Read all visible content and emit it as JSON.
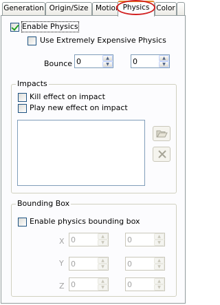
{
  "tabs": [
    {
      "label": "Generation",
      "active": false
    },
    {
      "label": "Origin/Size",
      "active": false
    },
    {
      "label": "Motion",
      "active": false
    },
    {
      "label": "Physics",
      "active": true
    },
    {
      "label": "Color",
      "active": false
    }
  ],
  "physics": {
    "enable_label": "Enable Physics",
    "enable_checked": true,
    "expensive_label": "Use Extremely Expensive Physics",
    "expensive_checked": false,
    "bounce_label": "Bounce",
    "bounce_value_1": "0",
    "bounce_value_2": "0"
  },
  "impacts": {
    "title": "Impacts",
    "kill_label": "Kill effect on impact",
    "kill_checked": false,
    "play_label": "Play new effect on impact",
    "play_checked": false,
    "effects_list": []
  },
  "bounding_box": {
    "title": "Bounding Box",
    "enable_label": "Enable physics bounding box",
    "enable_checked": false,
    "x_label": "X",
    "y_label": "Y",
    "z_label": "Z",
    "x_value_1": "0",
    "x_value_2": "0",
    "y_value_1": "0",
    "y_value_2": "0",
    "z_value_1": "0",
    "z_value_2": "0"
  },
  "icons": {
    "open": "folder-open-icon",
    "delete": "delete-x-icon"
  }
}
